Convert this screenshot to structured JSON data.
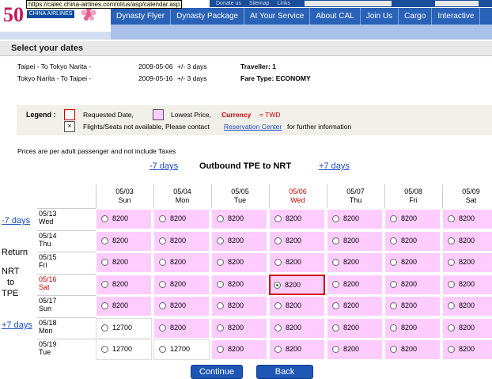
{
  "browser": {
    "status_url": "https://calec.china-airlines.com/ol/us/asp/calendar.asp"
  },
  "header": {
    "logo_text": "CHINA AIRLINES",
    "logo_number": "50",
    "top_links": [
      "Donate us",
      "Sitemap",
      "Links"
    ],
    "nav": [
      "Dynasty Flyer",
      "Dynasty Package",
      "At Your Service",
      "About CAL",
      "Join Us",
      "Cargo",
      "Interactive"
    ]
  },
  "page": {
    "title": "Select your dates"
  },
  "trip": {
    "outbound_route": "Taipei - To Tokyo Narita -",
    "outbound_date": "2009-05-06",
    "outbound_flex": "+/- 3 days",
    "traveller_label": "Traveller: 1",
    "return_route": "Tokyo Narita - To Taipei -",
    "return_date": "2009-05-16",
    "return_flex": "+/- 3 days",
    "fare_label": "Fare Type: ECONOMY"
  },
  "legend": {
    "title": "Legend :",
    "requested": "Requested Date,",
    "lowest": "Lowest Price,",
    "currency_label": "Currency",
    "currency_value": "= TWD",
    "na_text": "Flights/Seats not available, Please contact",
    "na_mark": "×",
    "link": "Reservation Center",
    "info": "for further information"
  },
  "notes": {
    "price_note": "Prices are per adult passenger and not include Taxes"
  },
  "outbound": {
    "prev_link": "-7 days",
    "title": "Outbound  TPE  to  NRT",
    "next_link": "+7 days"
  },
  "return_side": {
    "prev_link": "-7 days",
    "label_lines": [
      "Return",
      "NRT",
      "to",
      "TPE"
    ],
    "next_link": "+7 days"
  },
  "calendar": {
    "columns": [
      {
        "date": "05/03",
        "day": "Sun"
      },
      {
        "date": "05/04",
        "day": "Mon"
      },
      {
        "date": "05/05",
        "day": "Tue"
      },
      {
        "date": "05/06",
        "day": "Wed"
      },
      {
        "date": "05/07",
        "day": "Thu"
      },
      {
        "date": "05/08",
        "day": "Fri"
      },
      {
        "date": "05/09",
        "day": "Sat"
      }
    ],
    "rows": [
      {
        "date": "05/13",
        "day": "Wed",
        "prices": [
          "8200",
          "8200",
          "8200",
          "8200",
          "8200",
          "8200",
          "8200"
        ]
      },
      {
        "date": "05/14",
        "day": "Thu",
        "prices": [
          "8200",
          "8200",
          "8200",
          "8200",
          "8200",
          "8200",
          "8200"
        ]
      },
      {
        "date": "05/15",
        "day": "Fri",
        "prices": [
          "8200",
          "8200",
          "8200",
          "8200",
          "8200",
          "8200",
          "8200"
        ]
      },
      {
        "date": "05/16",
        "day": "Sat",
        "prices": [
          "8200",
          "8200",
          "8200",
          "8200",
          "8200",
          "8200",
          "8200"
        ]
      },
      {
        "date": "05/17",
        "day": "Sun",
        "prices": [
          "8200",
          "8200",
          "8200",
          "8200",
          "8200",
          "8200",
          "8200"
        ]
      },
      {
        "date": "05/18",
        "day": "Mon",
        "prices": [
          "12700",
          "8200",
          "8200",
          "8200",
          "8200",
          "8200",
          "8200"
        ]
      },
      {
        "date": "05/19",
        "day": "Tue",
        "prices": [
          "12700",
          "12700",
          "8200",
          "8200",
          "8200",
          "8200",
          "8200"
        ]
      }
    ],
    "selected_col": 3,
    "selected_row": 3
  },
  "colors": {
    "lowest": "#ffccff",
    "requested": "#cc0000",
    "nav": "#2a62b8",
    "link": "#1b4cc0"
  },
  "buttons": {
    "continue": "Continue",
    "back": "Back"
  }
}
